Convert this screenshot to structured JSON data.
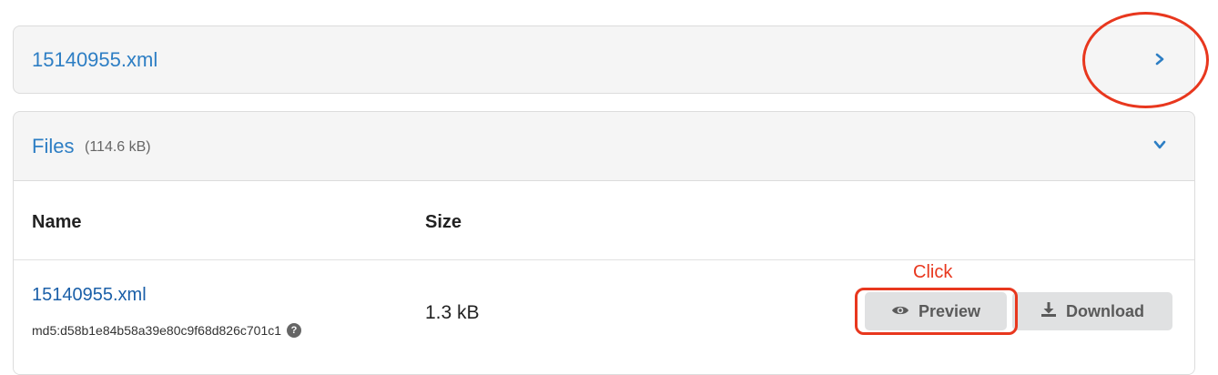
{
  "top_panel": {
    "title": "15140955.xml",
    "toggle_icon": "chevron-right-icon"
  },
  "files_panel": {
    "title": "Files",
    "total_size": "(114.6 kB)",
    "toggle_icon": "chevron-down-icon",
    "columns": [
      "Name",
      "Size"
    ],
    "rows": [
      {
        "name": "15140955.xml",
        "md5": "md5:d58b1e84b58a39e80c9f68d826c701c1",
        "size": "1.3 kB",
        "help_icon": "question-circle-icon",
        "actions": {
          "preview_label": "Preview",
          "preview_icon": "eye-icon",
          "download_label": "Download",
          "download_icon": "download-icon"
        }
      }
    ]
  },
  "annotations": {
    "click_label": "Click",
    "color": "#e8371e"
  },
  "colors": {
    "link": "#2d7ec4",
    "panel_bg": "#f5f5f5",
    "button_bg": "#e0e1e2"
  }
}
